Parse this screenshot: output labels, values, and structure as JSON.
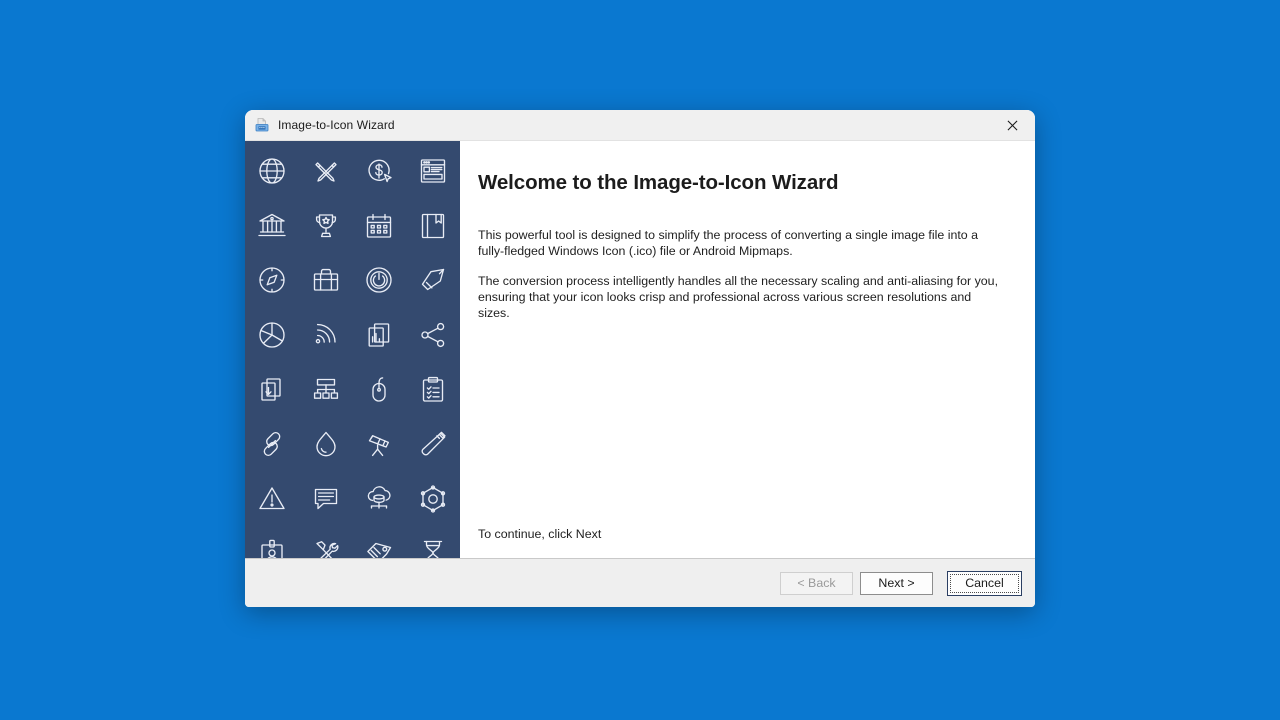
{
  "desktop": {
    "background_color": "#0a78d0"
  },
  "window": {
    "title": "Image-to-Icon Wizard",
    "title_icon": "printer-scanner-icon",
    "close_icon": "close-icon",
    "titlebar_color": "#f0f0f0",
    "sidebar_color": "#344a6f",
    "footer_color": "#efefef"
  },
  "sidebar": {
    "icons": [
      "globe-icon",
      "pen-pencil-cross-icon",
      "dollar-cursor-icon",
      "browser-window-icon",
      "bank-building-icon",
      "trophy-icon",
      "calendar-icon",
      "book-bookmark-icon",
      "compass-icon",
      "briefcase-icon",
      "power-button-icon",
      "tag-icon",
      "pie-chart-icon",
      "rss-signal-icon",
      "bar-chart-document-icon",
      "share-network-icon",
      "document-download-icon",
      "sitemap-hierarchy-icon",
      "computer-mouse-icon",
      "clipboard-checklist-icon",
      "chain-link-icon",
      "water-drop-icon",
      "telescope-icon",
      "usb-flash-drive-icon",
      "warning-triangle-icon",
      "chat-bubble-icon",
      "cloud-database-icon",
      "hexagon-network-icon",
      "id-badge-icon",
      "hammer-wrench-tools-icon",
      "price-tag-icon",
      "hourglass-icon"
    ]
  },
  "content": {
    "heading": "Welcome to the Image-to-Icon Wizard",
    "paragraph_1": "This powerful tool is designed to simplify the process of converting a single image file into a fully-fledged Windows Icon (.ico) file or Android Mipmaps.",
    "paragraph_2": "The conversion process intelligently handles all the necessary scaling and anti-aliasing for you, ensuring that your icon looks crisp and professional across various screen resolutions and sizes.",
    "continue_note": "To continue, click Next"
  },
  "footer": {
    "back_label": "< Back",
    "next_label": "Next >",
    "cancel_label": "Cancel"
  }
}
